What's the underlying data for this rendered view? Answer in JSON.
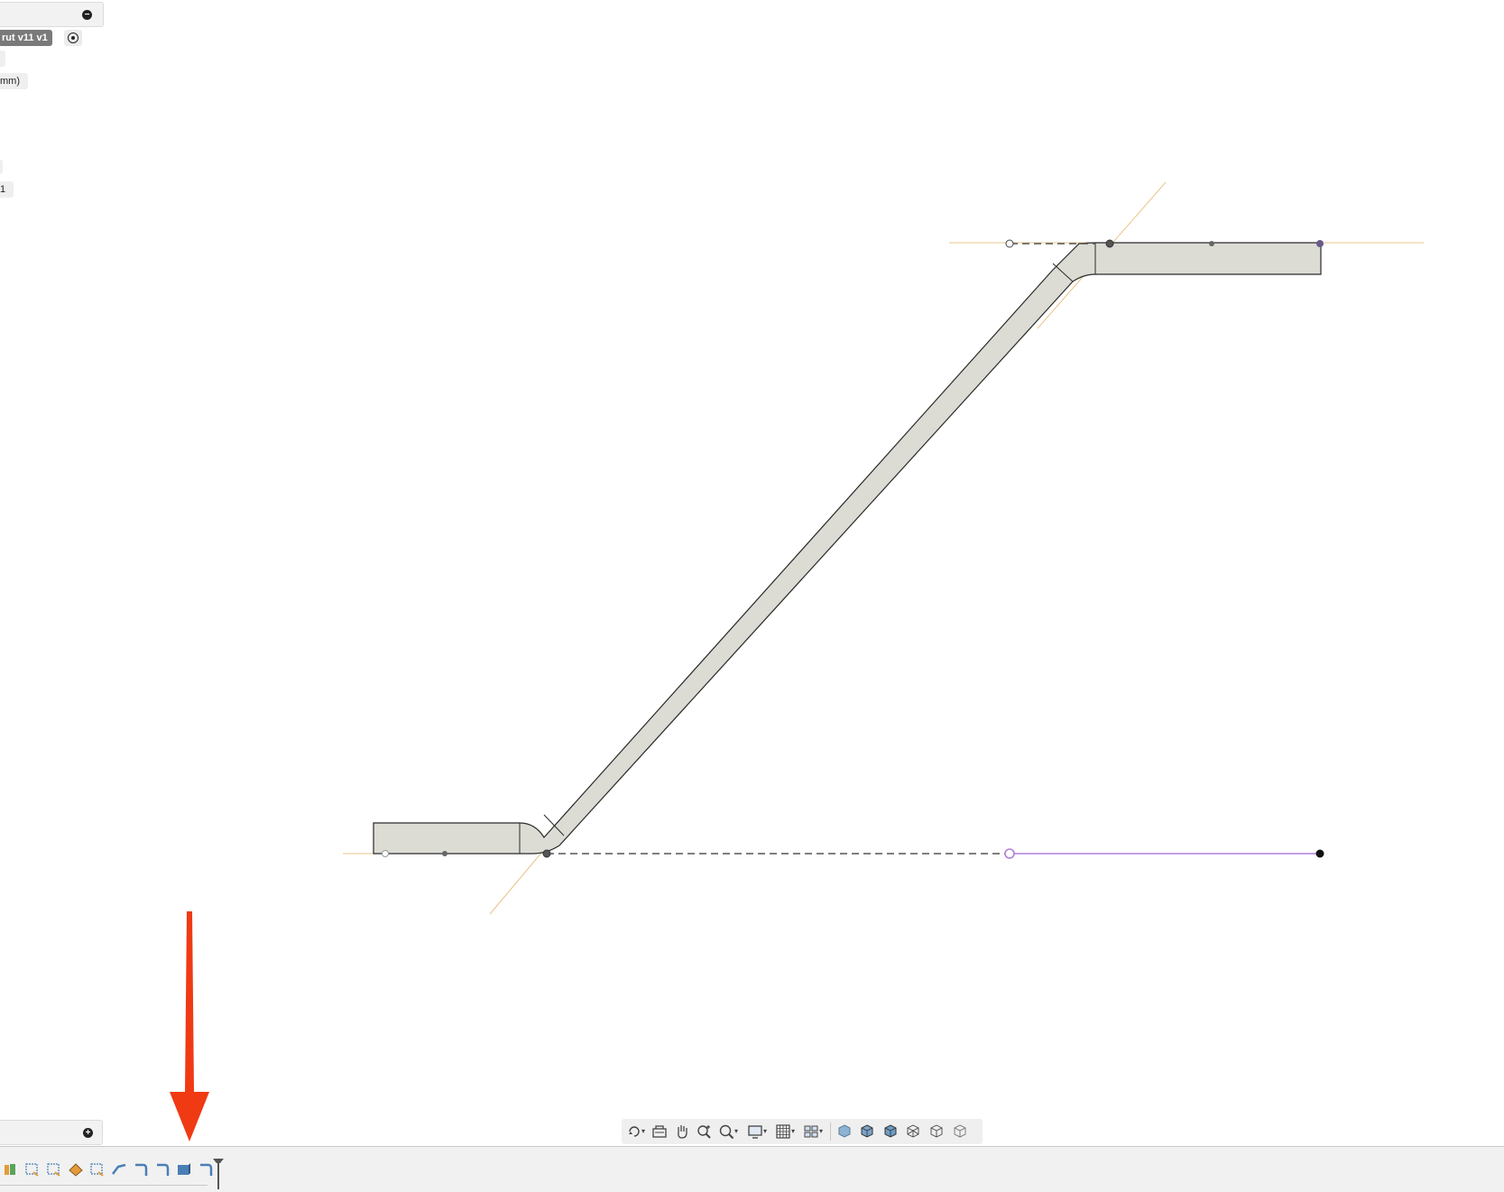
{
  "browser": {
    "document_label": "rut v11 v1",
    "units_label": "mm)",
    "index_label": "1"
  },
  "icons": {
    "collapse": "minus-circle-icon",
    "expand": "plus-circle-icon",
    "activate": "radio-target-icon"
  },
  "navbar": {
    "items": [
      "orbit",
      "look-at",
      "pan",
      "zoom",
      "zoom-window",
      "display-settings",
      "grid-settings",
      "viewports",
      "shaded",
      "shaded-hidden-edges",
      "shaded-visible-edges",
      "wireframe",
      "wireframe-hidden-edges",
      "wireframe-visible-edges"
    ]
  },
  "timeline": {
    "features": [
      "flange",
      "base-flange",
      "sketch-1",
      "sketch-2",
      "sketch-3",
      "sketch-4",
      "bend-1",
      "bend-2",
      "bend-3",
      "bend-4",
      "bend-5"
    ]
  },
  "colors": {
    "part_fill": "#dcdcd5",
    "construction": "#e8c48a",
    "constraint_purple": "#b07fd8",
    "arrow": "#f03a14"
  }
}
